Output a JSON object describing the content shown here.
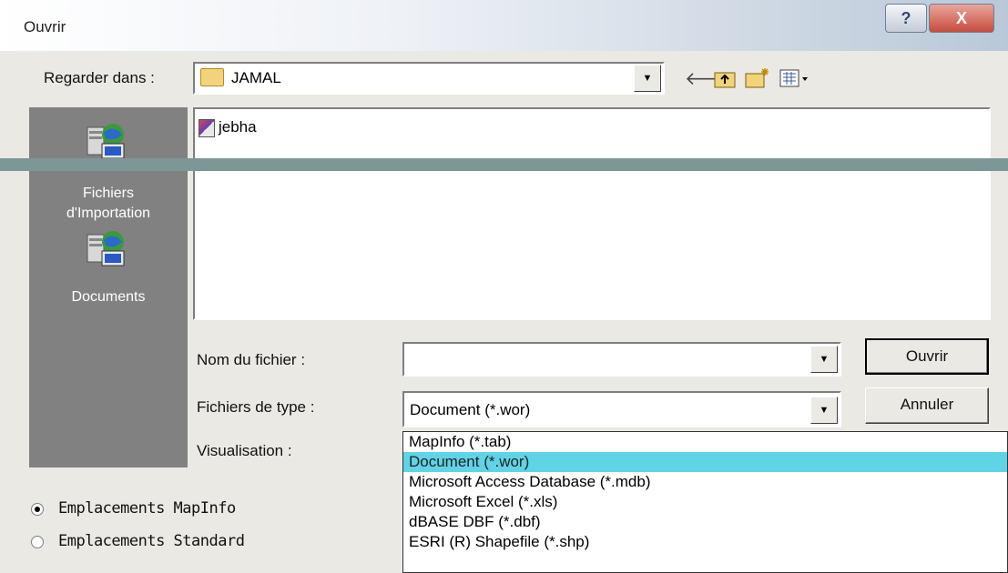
{
  "window": {
    "title": "Ouvrir",
    "help_label": "?",
    "close_label": "X"
  },
  "lookin": {
    "label": "Regarder dans :",
    "value": "JAMAL"
  },
  "toolbar": {
    "icons": [
      "back-arrow-icon",
      "up-folder-icon",
      "new-folder-icon",
      "view-menu-icon"
    ]
  },
  "places": [
    {
      "label": "Fichiers d'Importation",
      "line1": "Fichiers",
      "line2": "d'Importation",
      "icon": "network-computer-icon"
    },
    {
      "label": "Documents",
      "icon": "network-computer-icon"
    }
  ],
  "files": [
    {
      "name": "jebha",
      "icon": "workspace-file-icon"
    }
  ],
  "filename": {
    "label": "Nom du fichier :",
    "value": ""
  },
  "filetype": {
    "label": "Fichiers de type :",
    "value": "Document (*.wor)"
  },
  "preview": {
    "label": "Visualisation :"
  },
  "buttons": {
    "open": "Ouvrir",
    "cancel": "Annuler"
  },
  "filetype_options": [
    "MapInfo (*.tab)",
    "Document (*.wor)",
    "Microsoft Access Database (*.mdb)",
    "Microsoft Excel (*.xls)",
    "dBASE DBF (*.dbf)",
    "ESRI (R) Shapefile (*.shp)"
  ],
  "selected_option_index": 1,
  "locations": {
    "mapinfo": "Emplacements MapInfo",
    "standard": "Emplacements Standard",
    "checked": "mapinfo"
  },
  "colors": {
    "places_bg": "#818181",
    "selection": "#5fd4e6",
    "overlay_bar": "#7d9797"
  }
}
